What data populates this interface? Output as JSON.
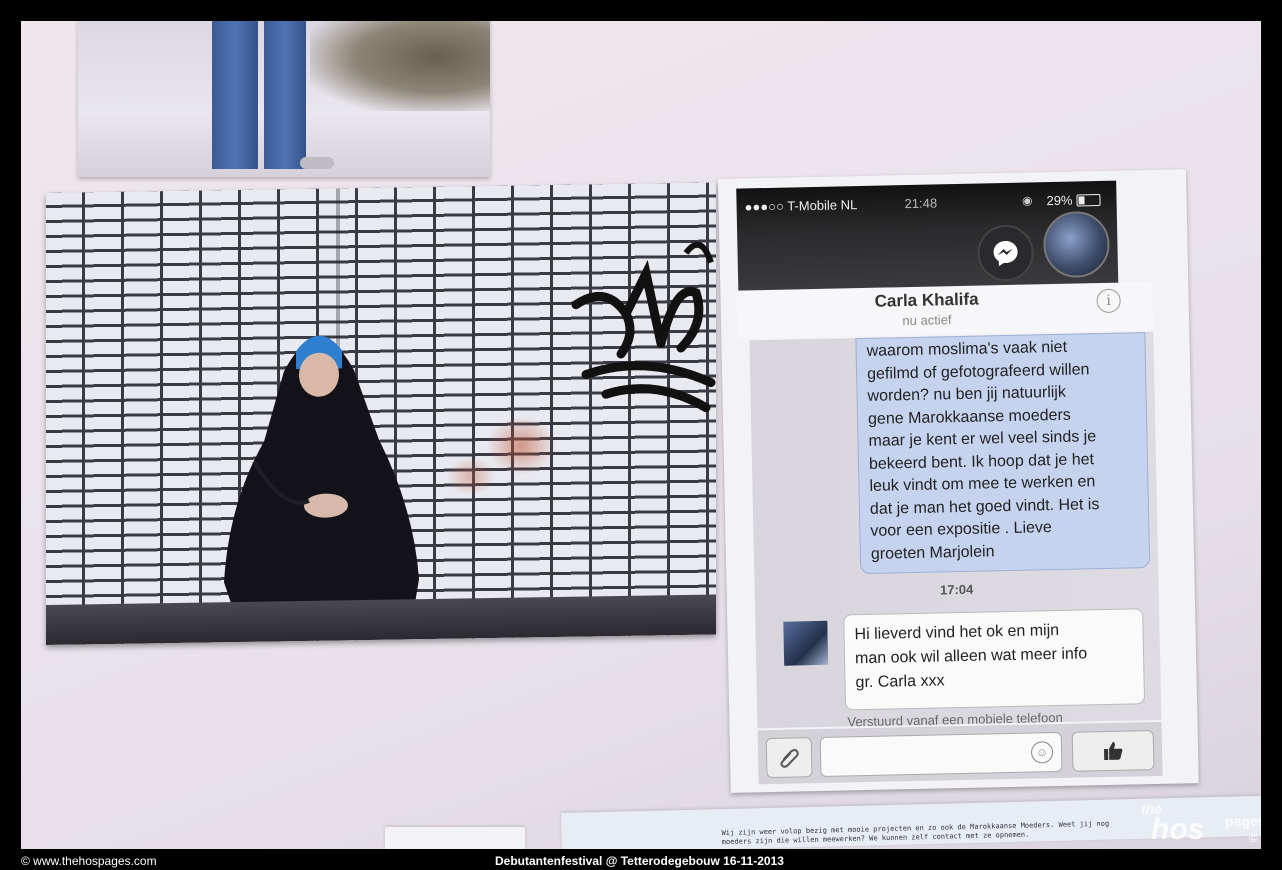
{
  "phone": {
    "carrier": "●●●○○ T-Mobile NL",
    "time": "21:48",
    "battery": "29%",
    "contact_name": "Carla Khalifa",
    "contact_status": "nu actief",
    "info_label": "i",
    "outgoing_message_lines": [
      "waarom moslima's vaak niet",
      "gefilmd of gefotografeerd willen",
      "worden? nu ben jij natuurlijk",
      "gene Marokkaanse moeders",
      "maar je kent er wel veel sinds je",
      "bekeerd bent. Ik hoop dat je het",
      "leuk vindt om mee te werken en",
      "dat je man het goed vindt. Het is",
      "voor een expositie . Lieve",
      "groeten Marjolein"
    ],
    "time_separator": "17:04",
    "incoming_message_lines": [
      "Hi lieverd vind het ok en mijn",
      "man ook wil alleen wat meer info",
      "gr. Carla xxx"
    ],
    "sent_from": "Verstuurd vanaf een mobiele telefoon"
  },
  "paper": {
    "line1": "Wij zijn weer volop bezig met mooie projecten en zo ook de Marokkaanse Moeders. Weet jij nog",
    "line2": "moeders zijn die willen meewerken? We kunnen zelf contact met ze opnemen."
  },
  "watermark": {
    "the": "the",
    "hos": "hos",
    "pages": "pages",
    "copy": "©"
  },
  "footer": {
    "site": "© www.thehospages.com",
    "caption": "Debutantenfestival @ Tetterodegebouw 16-11-2013"
  }
}
